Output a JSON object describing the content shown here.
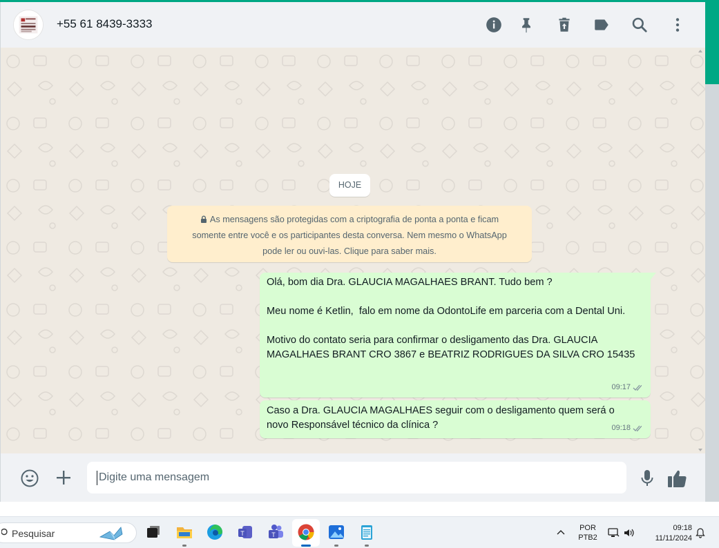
{
  "header": {
    "contact_name": "+55 61 8439-3333",
    "icons": [
      "info-icon",
      "pin-icon",
      "delete-icon",
      "label-icon",
      "search-icon",
      "menu-icon"
    ]
  },
  "chat": {
    "date_chip": "HOJE",
    "encryption_notice": {
      "line1": "As mensagens são protegidas com a criptografia de ponta a ponta e ficam",
      "line2": "somente entre você e os participantes desta conversa. Nem mesmo o WhatsApp",
      "line3": "pode ler ou ouvi-las. Clique para saber mais."
    },
    "messages": [
      {
        "text": "Olá, bom dia Dra. GLAUCIA MAGALHAES BRANT. Tudo bem ?\n\nMeu nome é Ketlin,  falo em nome da OdontoLife em parceria com a Dental Uni.\n\nMotivo do contato seria para confirmar o desligamento das Dra. GLAUCIA MAGALHAES BRANT CRO 3867 e BEATRIZ RODRIGUES DA SILVA CRO 15435",
        "time": "09:17",
        "status": "delivered"
      },
      {
        "text": "Caso a Dra. GLAUCIA MAGALHAES seguir com o desligamento quem será o novo Responsável técnico da clínica ?",
        "time": "09:18",
        "status": "delivered"
      }
    ]
  },
  "composer": {
    "placeholder": "Digite uma mensagem"
  },
  "taskbar": {
    "search_label": "Pesquisar",
    "language": {
      "line1": "POR",
      "line2": "PTB2"
    },
    "clock": {
      "time": "09:18",
      "date": "11/11/2024"
    }
  },
  "colors": {
    "accent": "#00a884",
    "outgoing_bubble": "#d9fdd3",
    "notice_bg": "#ffeecd",
    "chat_bg": "#efeae2"
  }
}
